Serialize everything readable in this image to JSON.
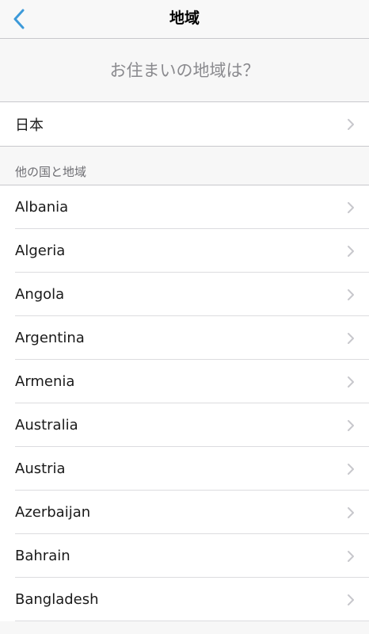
{
  "nav": {
    "title": "地域"
  },
  "question": "お住まいの地域は？",
  "current_region": "日本",
  "section_header": "他の国と地域",
  "countries": [
    "Albania",
    "Algeria",
    "Angola",
    "Argentina",
    "Armenia",
    "Australia",
    "Austria",
    "Azerbaijan",
    "Bahrain",
    "Bangladesh"
  ],
  "colors": {
    "accent": "#3d9ad9",
    "chevron": "#c7c7cc"
  },
  "icons": {
    "back": "chevron-left-icon",
    "row": "chevron-right-icon"
  }
}
